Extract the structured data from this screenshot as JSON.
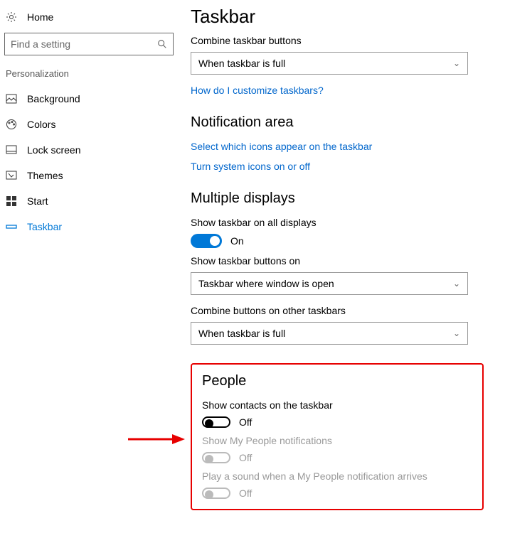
{
  "sidebar": {
    "home": "Home",
    "search_placeholder": "Find a setting",
    "section": "Personalization",
    "items": [
      {
        "label": "Background"
      },
      {
        "label": "Colors"
      },
      {
        "label": "Lock screen"
      },
      {
        "label": "Themes"
      },
      {
        "label": "Start"
      },
      {
        "label": "Taskbar"
      }
    ]
  },
  "page": {
    "title": "Taskbar",
    "combine_label": "Combine taskbar buttons",
    "combine_value": "When taskbar is full",
    "customize_link": "How do I customize taskbars?",
    "notif_heading": "Notification area",
    "notif_link1": "Select which icons appear on the taskbar",
    "notif_link2": "Turn system icons on or off",
    "multi_heading": "Multiple displays",
    "multi_all_label": "Show taskbar on all displays",
    "multi_all_state": "On",
    "multi_buttons_label": "Show taskbar buttons on",
    "multi_buttons_value": "Taskbar where window is open",
    "multi_combine_label": "Combine buttons on other taskbars",
    "multi_combine_value": "When taskbar is full",
    "people_heading": "People",
    "people_contacts_label": "Show contacts on the taskbar",
    "people_contacts_state": "Off",
    "people_notif_label": "Show My People notifications",
    "people_notif_state": "Off",
    "people_sound_label": "Play a sound when a My People notification arrives",
    "people_sound_state": "Off"
  },
  "colors": {
    "accent": "#0078d7",
    "link": "#0066cc",
    "highlight_border": "#e70000"
  }
}
